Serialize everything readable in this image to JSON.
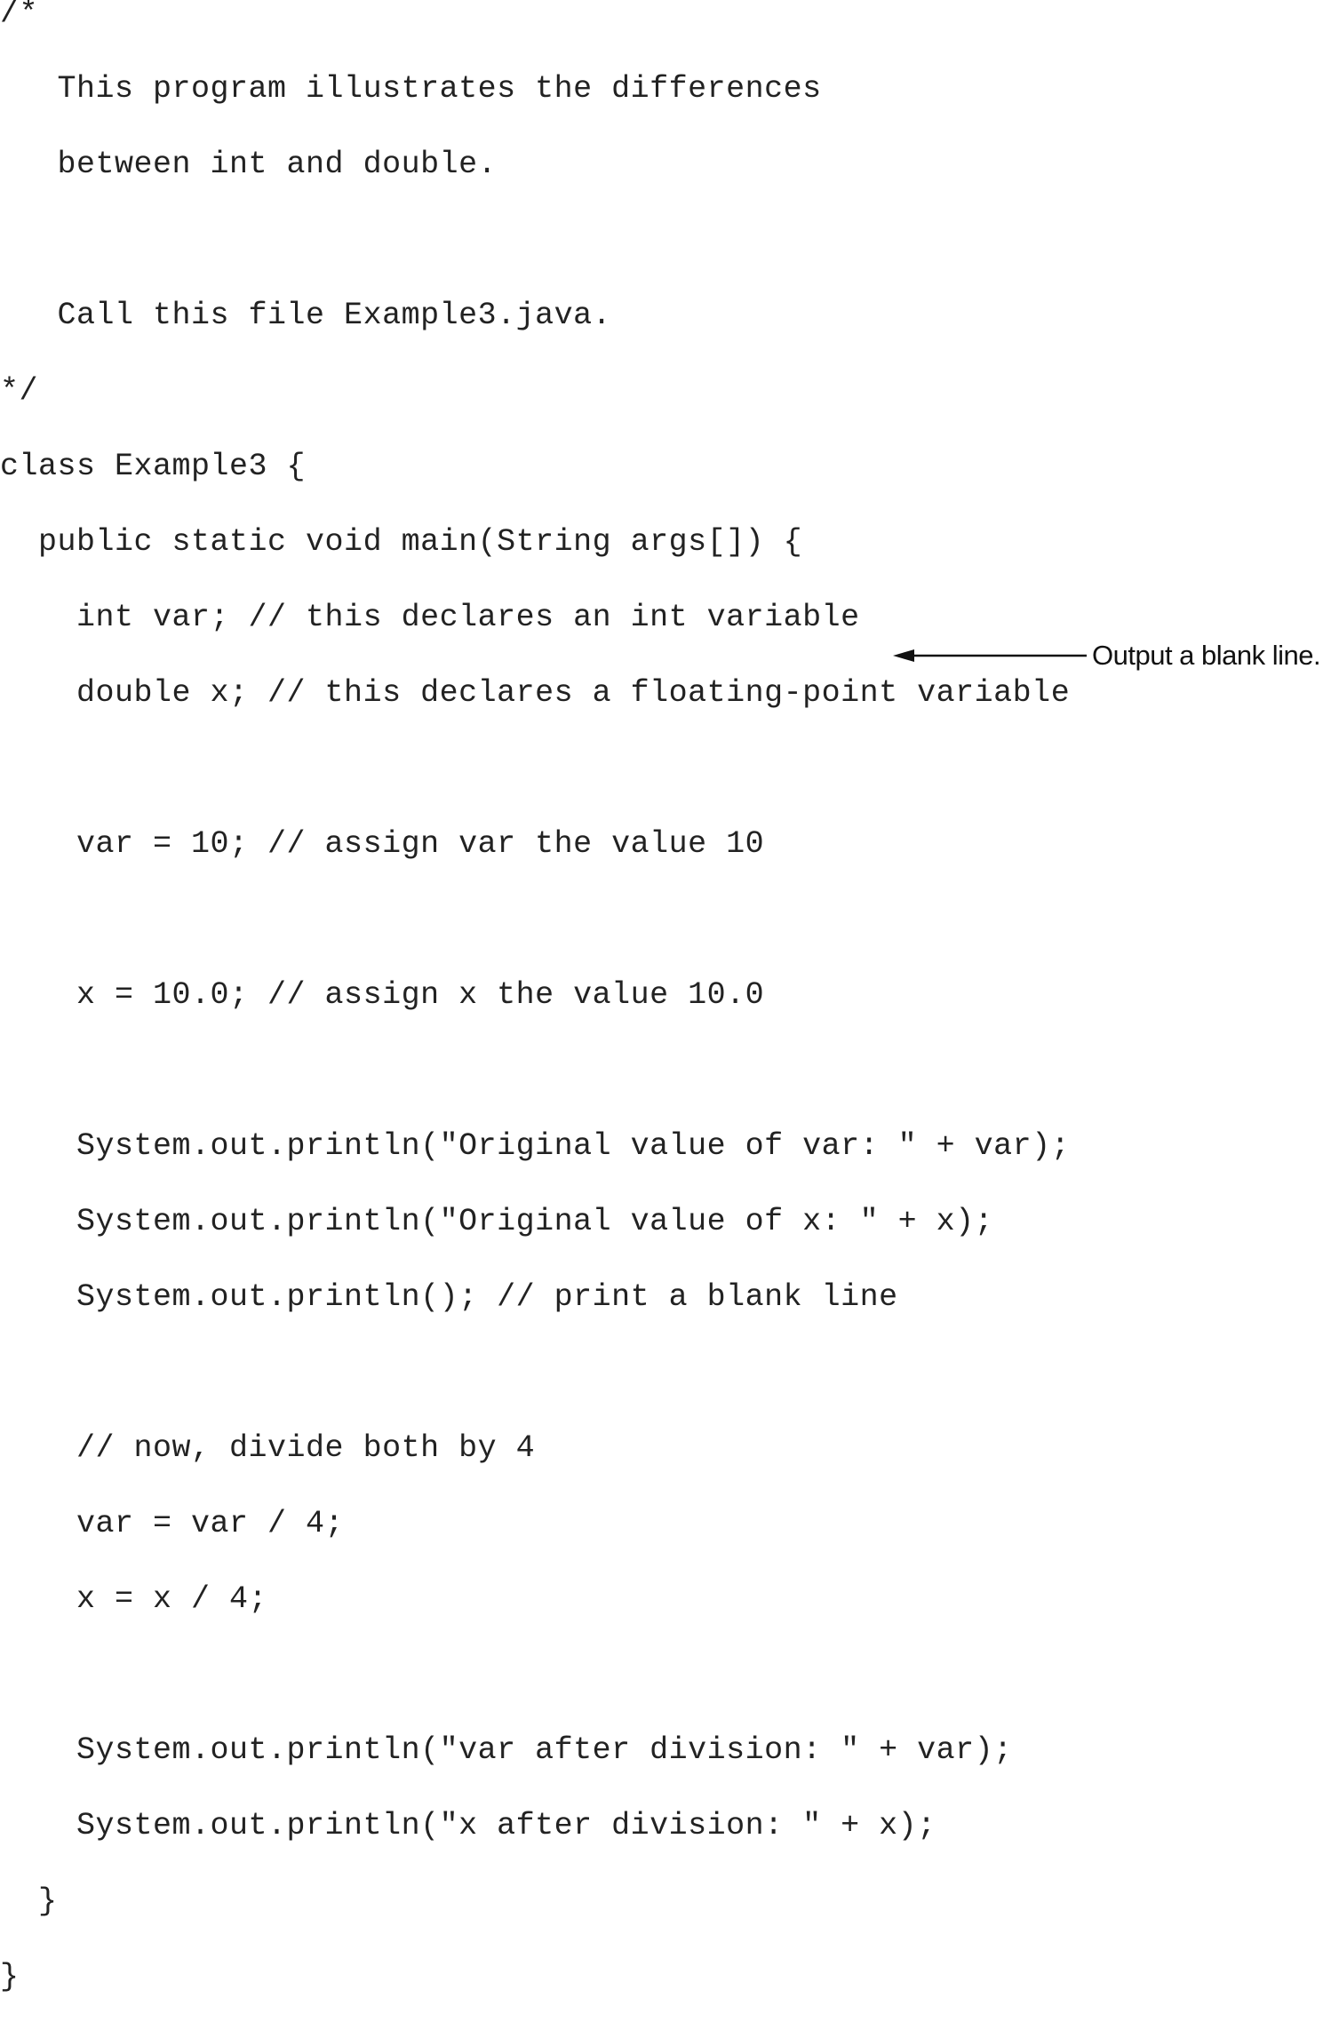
{
  "code": {
    "lines": [
      "/*",
      "   This program illustrates the differences",
      "   between int and double.",
      "",
      "   Call this file Example3.java.",
      "*/",
      "class Example3 {",
      "  public static void main(String args[]) {",
      "    int var; // this declares an int variable",
      "    double x; // this declares a floating-point variable",
      "",
      "    var = 10; // assign var the value 10",
      "",
      "    x = 10.0; // assign x the value 10.0",
      "",
      "    System.out.println(\"Original value of var: \" + var);",
      "    System.out.println(\"Original value of x: \" + x);",
      "    System.out.println(); // print a blank line",
      "",
      "    // now, divide both by 4",
      "    var = var / 4;",
      "    x = x / 4;",
      "",
      "    System.out.println(\"var after division: \" + var);",
      "    System.out.println(\"x after division: \" + x);",
      "  }",
      "}"
    ]
  },
  "callout": {
    "label": "Output a blank line.",
    "target_line": 17
  }
}
